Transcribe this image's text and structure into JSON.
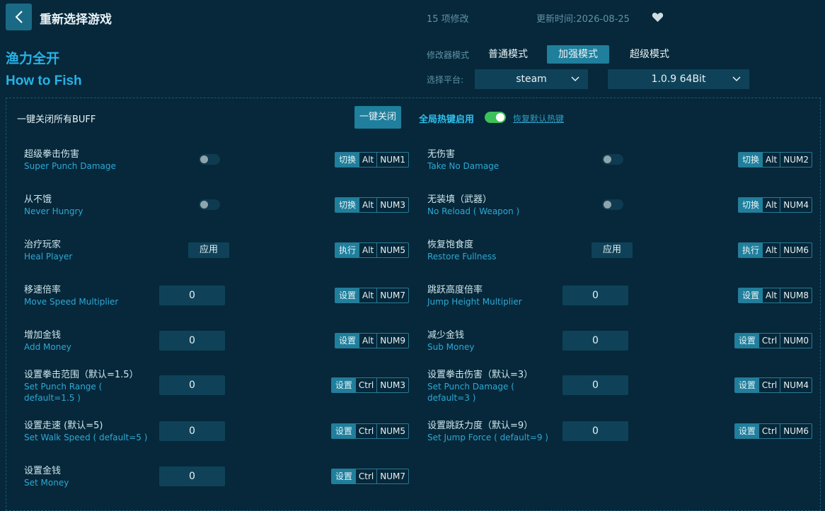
{
  "header": {
    "back_icon": "chevron-left-icon",
    "title": "重新选择游戏",
    "mod_count": "15 项修改",
    "update_time": "更新时间:2026-08-25",
    "favorite_icon": "heart-icon"
  },
  "game": {
    "name_cn": "渔力全开",
    "name_en": "How to Fish"
  },
  "mode": {
    "label": "修改器模式",
    "options": [
      "普通模式",
      "加强模式",
      "超级模式"
    ],
    "selected": "加强模式"
  },
  "platform": {
    "label": "选择平台:",
    "platform_value": "steam",
    "version_value": "1.0.9 64Bit"
  },
  "controls": {
    "all_off_label": "一键关闭所有BUFF",
    "all_off_button": "一键关闭",
    "hotkey_label": "全局热键启用",
    "hotkey_enabled": true,
    "restore_link": "恢复默认热键"
  },
  "items": [
    {
      "cn": "超级拳击伤害",
      "en": "Super Punch Damage",
      "type": "toggle",
      "action": "切换",
      "mod": "Alt",
      "key": "NUM1"
    },
    {
      "cn": "无伤害",
      "en": "Take No Damage",
      "type": "toggle",
      "action": "切换",
      "mod": "Alt",
      "key": "NUM2"
    },
    {
      "cn": "从不饿",
      "en": "Never Hungry",
      "type": "toggle",
      "action": "切换",
      "mod": "Alt",
      "key": "NUM3"
    },
    {
      "cn": "无装填（武器）",
      "en": "No Reload ( Weapon )",
      "type": "toggle",
      "action": "切换",
      "mod": "Alt",
      "key": "NUM4"
    },
    {
      "cn": "治疗玩家",
      "en": "Heal Player",
      "type": "apply",
      "button": "应用",
      "action": "执行",
      "mod": "Alt",
      "key": "NUM5"
    },
    {
      "cn": "恢复饱食度",
      "en": "Restore Fullness",
      "type": "apply",
      "button": "应用",
      "action": "执行",
      "mod": "Alt",
      "key": "NUM6"
    },
    {
      "cn": "移速倍率",
      "en": "Move Speed Multiplier",
      "type": "input",
      "value": "0",
      "action": "设置",
      "mod": "Alt",
      "key": "NUM7"
    },
    {
      "cn": "跳跃高度倍率",
      "en": "Jump Height Multiplier",
      "type": "input",
      "value": "0",
      "action": "设置",
      "mod": "Alt",
      "key": "NUM8"
    },
    {
      "cn": "增加金钱",
      "en": "Add Money",
      "type": "input",
      "value": "0",
      "action": "设置",
      "mod": "Alt",
      "key": "NUM9"
    },
    {
      "cn": "减少金钱",
      "en": "Sub Money",
      "type": "input",
      "value": "0",
      "action": "设置",
      "mod": "Ctrl",
      "key": "NUM0"
    },
    {
      "cn": "设置拳击范围（默认=1.5）",
      "en": "Set Punch Range (",
      "en2": "default=1.5 )",
      "type": "input",
      "value": "0",
      "action": "设置",
      "mod": "Ctrl",
      "key": "NUM3"
    },
    {
      "cn": "设置拳击伤害（默认=3）",
      "en": "Set Punch Damage (",
      "en2": "default=3 )",
      "type": "input",
      "value": "0",
      "action": "设置",
      "mod": "Ctrl",
      "key": "NUM4"
    },
    {
      "cn": "设置走速 (默认=5)",
      "en": "Set Walk Speed ( default=5 )",
      "type": "input",
      "value": "0",
      "action": "设置",
      "mod": "Ctrl",
      "key": "NUM5"
    },
    {
      "cn": "设置跳跃力度（默认=9）",
      "en": "Set Jump Force ( default=9 )",
      "type": "input",
      "value": "0",
      "action": "设置",
      "mod": "Ctrl",
      "key": "NUM6"
    },
    {
      "cn": "设置金钱",
      "en": "Set Money",
      "type": "input",
      "value": "0",
      "action": "设置",
      "mod": "Ctrl",
      "key": "NUM7"
    }
  ]
}
